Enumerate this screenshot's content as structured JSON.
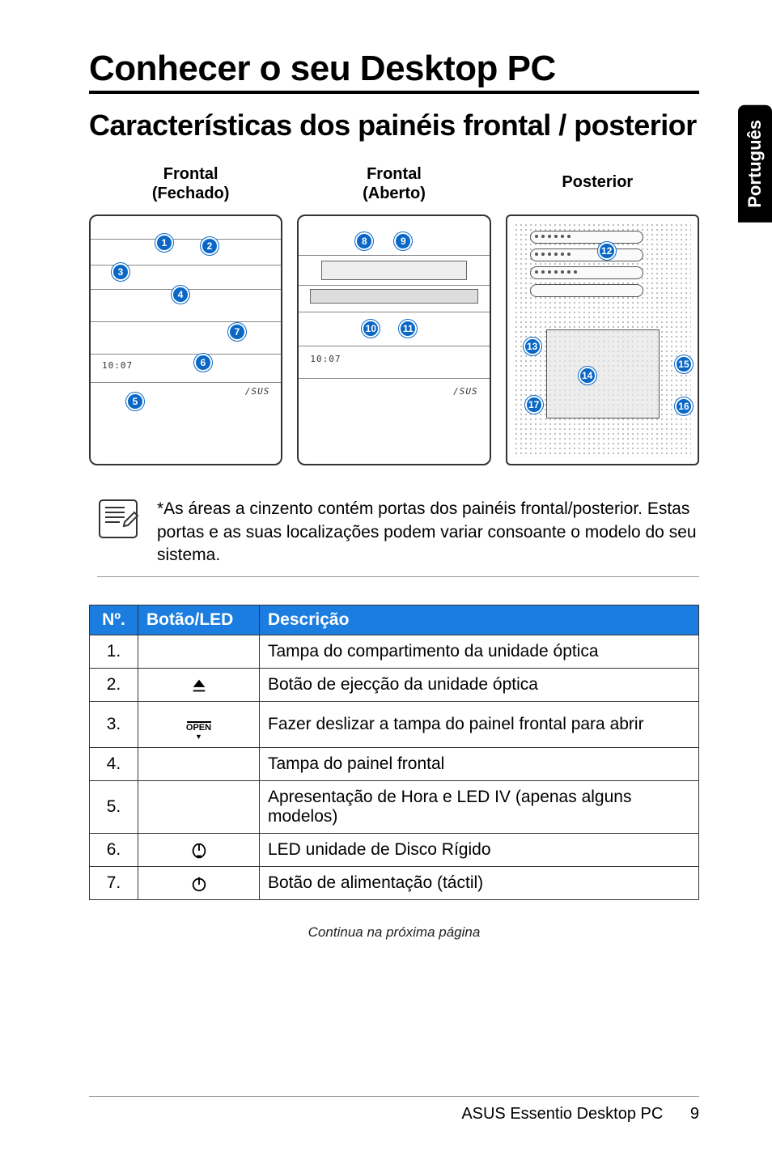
{
  "side_tab": "Português",
  "chapter_title": "Conhecer o seu Desktop PC",
  "section_title": "Características dos painéis frontal / posterior",
  "panel_labels": {
    "front_closed_l1": "Frontal",
    "front_closed_l2": "(Fechado)",
    "front_open_l1": "Frontal",
    "front_open_l2": "(Aberto)",
    "rear": "Posterior"
  },
  "diagram_time": "10:07",
  "brand_text": "/SUS",
  "callouts": {
    "c1": "1",
    "c2": "2",
    "c3": "3",
    "c4": "4",
    "c5": "5",
    "c6": "6",
    "c7": "7",
    "c8": "8",
    "c9": "9",
    "c10": "10",
    "c11": "11",
    "c12": "12",
    "c13": "13",
    "c14": "14",
    "c15": "15",
    "c16": "16",
    "c17": "17"
  },
  "note_text": "*As áreas a cinzento contém portas dos painéis frontal/posterior. Estas portas e as suas localizações podem variar consoante o modelo do seu sistema.",
  "table": {
    "headers": {
      "no": "Nº.",
      "button": "Botão/LED",
      "desc": "Descrição"
    },
    "rows": [
      {
        "no": "1.",
        "icon": "",
        "desc": "Tampa do compartimento da unidade óptica"
      },
      {
        "no": "2.",
        "icon": "eject",
        "desc": "Botão de ejecção da unidade óptica"
      },
      {
        "no": "3.",
        "icon": "open",
        "desc": "Fazer deslizar a tampa do painel frontal para abrir"
      },
      {
        "no": "4.",
        "icon": "",
        "desc": "Tampa do painel frontal"
      },
      {
        "no": "5.",
        "icon": "",
        "desc": "Apresentação de Hora e LED IV (apenas alguns modelos)"
      },
      {
        "no": "6.",
        "icon": "hdd",
        "desc": "LED unidade de Disco Rígido"
      },
      {
        "no": "7.",
        "icon": "power",
        "desc": "Botão de alimentação (táctil)"
      }
    ]
  },
  "open_label": "OPEN",
  "continue_text": "Continua na próxima página",
  "footer": {
    "product": "ASUS Essentio Desktop PC",
    "page": "9"
  }
}
